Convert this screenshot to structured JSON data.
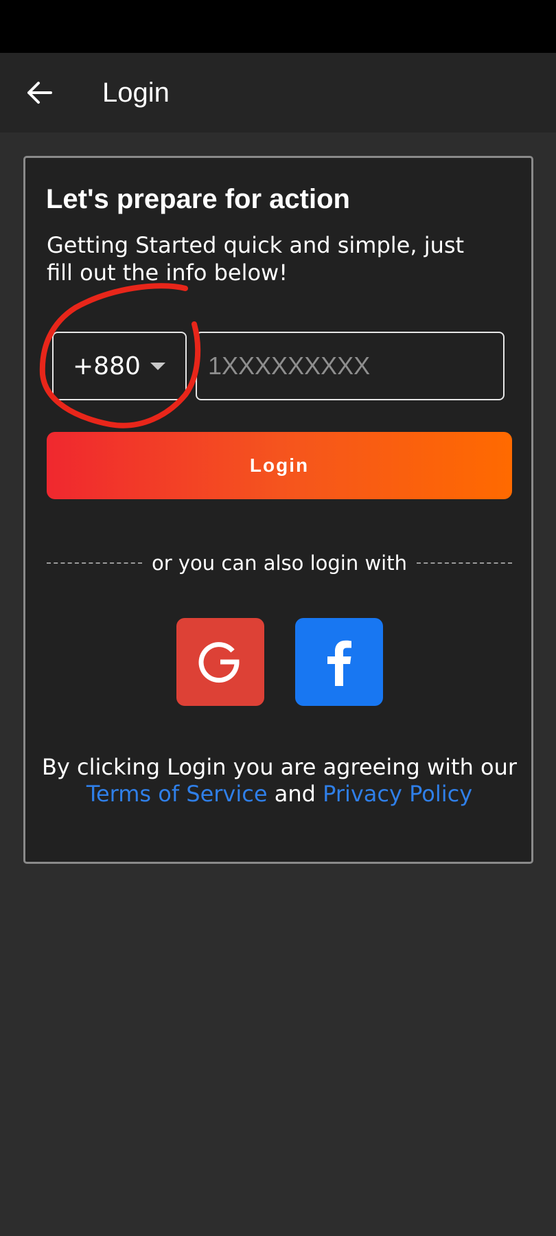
{
  "app_bar": {
    "title": "Login",
    "back_icon": "arrow-left-icon"
  },
  "card": {
    "heading": "Let's prepare for action",
    "subtitle": "Getting Started quick and simple, just fill out the info below!",
    "country_code": {
      "value": "+880",
      "icon": "caret-down-icon"
    },
    "phone": {
      "value": "",
      "placeholder": "1XXXXXXXXX"
    },
    "login_button": "Login",
    "divider_text": "or you can also login with",
    "social": {
      "google_icon": "google-icon",
      "google_color": "#dd4136",
      "facebook_icon": "facebook-icon",
      "facebook_color": "#1877f2"
    },
    "legal": {
      "prefix": "By clicking Login you are agreeing with our",
      "terms": "Terms of Service",
      "conjunction": "and",
      "privacy": "Privacy Policy",
      "link_color": "#2f7fe8"
    }
  },
  "colors": {
    "background": "#2d2d2d",
    "app_bar": "#252525",
    "card": "#212121",
    "gradient_start": "#f0282f",
    "gradient_end": "#ff6a00",
    "annotation": "#e8261a"
  }
}
